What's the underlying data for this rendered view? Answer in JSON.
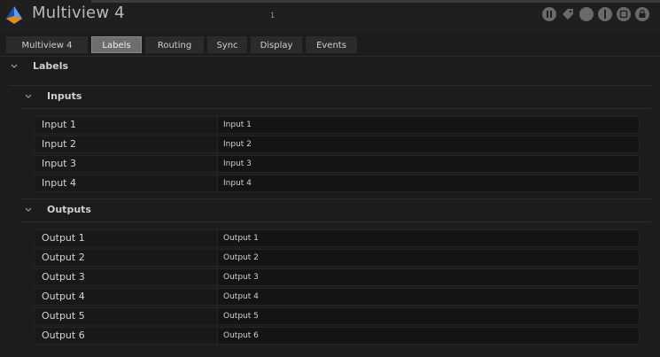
{
  "window": {
    "title": "Multiview 4",
    "small_mark": "1"
  },
  "header_icons": [
    "pause-icon",
    "tag-icon",
    "record-icon",
    "info-icon",
    "stop-icon",
    "lock-icon"
  ],
  "tabs": [
    {
      "label": "Multiview 4",
      "active": false
    },
    {
      "label": "Labels",
      "active": true
    },
    {
      "label": "Routing",
      "active": false
    },
    {
      "label": "Sync",
      "active": false
    },
    {
      "label": "Display",
      "active": false
    },
    {
      "label": "Events",
      "active": false
    }
  ],
  "labels_section": {
    "title": "Labels"
  },
  "inputs": {
    "title": "Inputs",
    "rows": [
      {
        "label": "Input 1",
        "value": "Input 1"
      },
      {
        "label": "Input 2",
        "value": "Input 2"
      },
      {
        "label": "Input 3",
        "value": "Input 3"
      },
      {
        "label": "Input 4",
        "value": "Input 4"
      }
    ]
  },
  "outputs": {
    "title": "Outputs",
    "rows": [
      {
        "label": "Output 1",
        "value": "Output 1"
      },
      {
        "label": "Output 2",
        "value": "Output 2"
      },
      {
        "label": "Output 3",
        "value": "Output 3"
      },
      {
        "label": "Output 4",
        "value": "Output 4"
      },
      {
        "label": "Output 5",
        "value": "Output 5"
      },
      {
        "label": "Output 6",
        "value": "Output 6"
      }
    ]
  }
}
